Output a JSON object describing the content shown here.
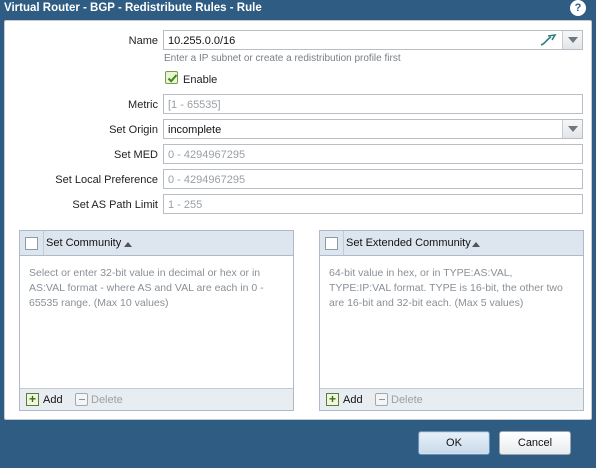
{
  "dialog": {
    "title": "Virtual Router - BGP - Redistribute Rules - Rule",
    "help_glyph": "?"
  },
  "form": {
    "name": {
      "label": "Name",
      "value": "10.255.0.0/16",
      "hint": "Enter a IP subnet or create a redistribution profile first"
    },
    "enable": {
      "label": "Enable",
      "checked": true
    },
    "metric": {
      "label": "Metric",
      "placeholder": "[1 - 65535]"
    },
    "set_origin": {
      "label": "Set Origin",
      "value": "incomplete"
    },
    "set_med": {
      "label": "Set MED",
      "placeholder": "0 - 4294967295"
    },
    "set_local_preference": {
      "label": "Set Local Preference",
      "placeholder": "0 - 4294967295"
    },
    "set_as_path_limit": {
      "label": "Set AS Path Limit",
      "placeholder": "1 - 255"
    }
  },
  "community_panel": {
    "title": "Set Community",
    "placeholder": "Select or enter 32-bit value in decimal or hex or in AS:VAL format - where AS and VAL are each in 0 - 65535 range. (Max 10 values)",
    "add_label": "Add",
    "delete_label": "Delete"
  },
  "ext_community_panel": {
    "title": "Set Extended Community",
    "placeholder": "64-bit value in hex, or in TYPE:AS:VAL, TYPE:IP:VAL format. TYPE is 16-bit, the other two are 16-bit and 32-bit each. (Max 5 values)",
    "add_label": "Add",
    "delete_label": "Delete"
  },
  "buttons": {
    "ok": "OK",
    "cancel": "Cancel"
  },
  "colors": {
    "title_bar": "#2e5c82",
    "panel_header": "#dde6ef",
    "ok_button_border": "#6c8fb4"
  },
  "icons": [
    "help-icon",
    "profile-link-icon",
    "dropdown-caret-icon",
    "checkbox-icon",
    "sort-asc-icon",
    "add-icon",
    "delete-icon"
  ]
}
